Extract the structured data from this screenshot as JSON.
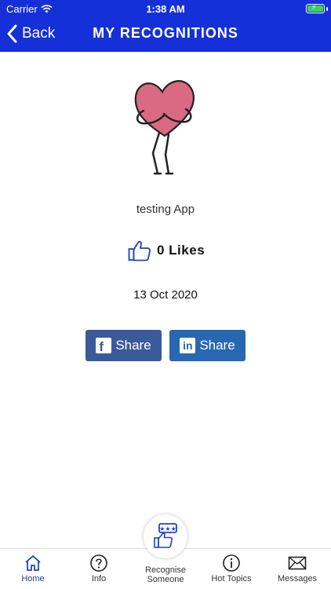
{
  "status_bar": {
    "carrier": "Carrier",
    "time": "1:38 AM"
  },
  "nav": {
    "back_label": "Back",
    "title": "MY RECOGNITIONS"
  },
  "recognition": {
    "title": "testing App",
    "likes": "0 Likes",
    "date": "13 Oct 2020"
  },
  "share": {
    "facebook_label": "Share",
    "linkedin_label": "Share"
  },
  "tabs": [
    {
      "label": "Home",
      "icon": "home-icon"
    },
    {
      "label": "Info",
      "icon": "question-circle-icon"
    },
    {
      "label": "Recognise\nSomeone",
      "icon": "thumbs-up-stars-icon"
    },
    {
      "label": "Hot Topics",
      "icon": "info-circle-icon"
    },
    {
      "label": "Messages",
      "icon": "envelope-icon"
    }
  ],
  "colors": {
    "header": "#1530d8",
    "facebook": "#3b5a9a",
    "linkedin": "#2867b2",
    "accent": "#1a3ea6",
    "heart": "#d4506e"
  }
}
